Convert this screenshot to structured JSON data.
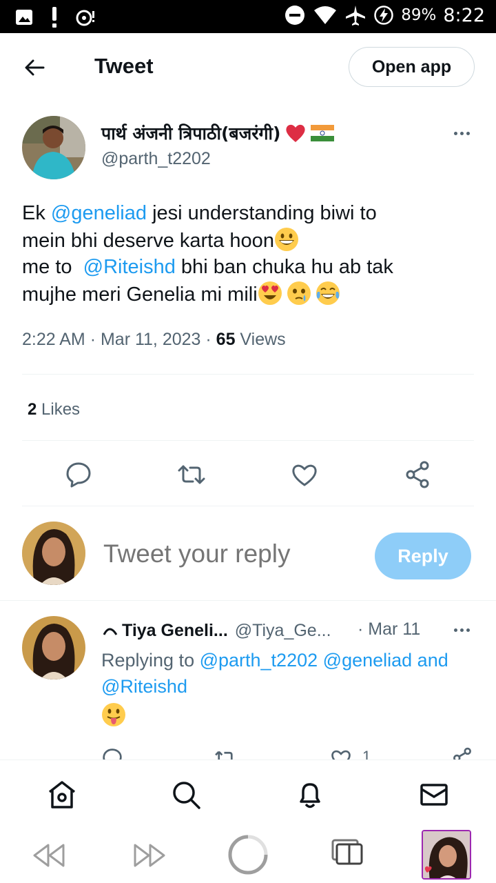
{
  "status_bar": {
    "battery_percent": "89%",
    "time": "8:22"
  },
  "header": {
    "title": "Tweet",
    "open_app_label": "Open app"
  },
  "tweet": {
    "author_name": "पार्थ अंजनी त्रिपाठी(बजरंगी)",
    "author_handle": "@parth_t2202",
    "text": {
      "l1_pre": "Ek ",
      "l1_mention": "@geneliad",
      "l1_post": " jesi understanding biwi to",
      "l2": "mein bhi deserve karta hoon",
      "l3_pre": "me to  ",
      "l3_mention": "@Riteishd",
      "l3_post": " bhi ban chuka hu ab tak",
      "l4": "mujhe meri Genelia mi mili"
    },
    "time": "2:22 AM",
    "date": "Mar 11, 2023",
    "views_count": "65",
    "views_label": " Views",
    "likes_count": "2",
    "likes_label": " Likes"
  },
  "composer": {
    "placeholder": "Tweet your reply",
    "reply_label": "Reply"
  },
  "reply": {
    "name": "Tiya Geneli...",
    "handle": "@Tiya_Ge...",
    "date": "· Mar 11",
    "replying_to_label": "Replying to ",
    "replying_to_1": "@parth_t2202",
    "replying_to_2": "@geneliad",
    "replying_and": " and",
    "replying_to_3": "@Riteishd",
    "like_count": "1"
  },
  "colors": {
    "accent": "#1d9bf0",
    "text_secondary": "#536471",
    "reply_button_disabled": "#8ecdf8"
  },
  "icons": [
    "back-arrow-icon",
    "more-icon",
    "reply-icon",
    "retweet-icon",
    "like-icon",
    "share-icon",
    "home-icon",
    "search-icon",
    "bell-icon",
    "mail-icon"
  ]
}
